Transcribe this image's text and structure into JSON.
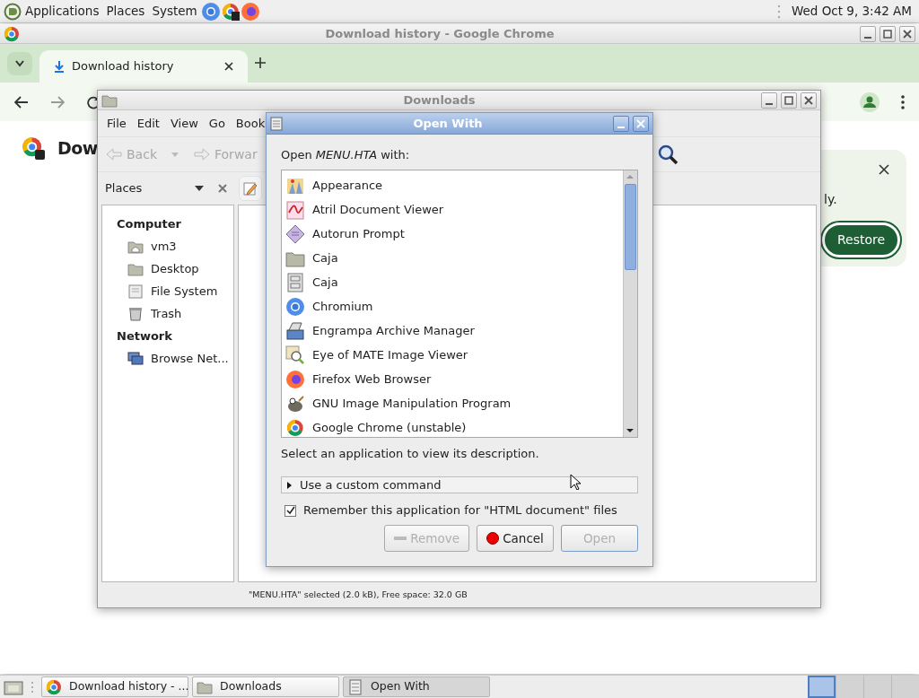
{
  "top_panel": {
    "menus": [
      {
        "label": "Applications"
      },
      {
        "label": "Places"
      },
      {
        "label": "System"
      }
    ],
    "clock": "Wed Oct 9, 3:42 AM"
  },
  "browser": {
    "title": "Download history - Google Chrome",
    "tabs": [
      {
        "label": "Download history",
        "selected": true
      }
    ],
    "page_title": "Dow",
    "notice_text": "ly.",
    "restore_button": "Restore"
  },
  "file_manager": {
    "title": "Downloads",
    "menus": [
      "File",
      "Edit",
      "View",
      "Go",
      "Book"
    ],
    "toolbar": [
      {
        "label": "Back",
        "kind": "back",
        "disabled": true
      },
      {
        "label": "Forwar",
        "kind": "forward",
        "disabled": true
      }
    ],
    "sidebar_title": "Places",
    "sidebar": [
      {
        "heading": "Computer",
        "items": [
          {
            "label": "vm3",
            "kind": "home"
          },
          {
            "label": "Desktop",
            "kind": "desktop"
          },
          {
            "label": "File System",
            "kind": "drive"
          },
          {
            "label": "Trash",
            "kind": "trash"
          }
        ]
      },
      {
        "heading": "Network",
        "items": [
          {
            "label": "Browse Net...",
            "kind": "network"
          }
        ]
      }
    ],
    "status": "\"MENU.HTA\" selected (2.0 kB), Free space: 32.0 GB"
  },
  "dialog": {
    "title": "Open With",
    "prompt": "Open *MENU.HTA* with:",
    "apps": [
      {
        "name": "Appearance",
        "kind": "appearance"
      },
      {
        "name": "Atril Document Viewer",
        "kind": "pdf"
      },
      {
        "name": "Autorun Prompt",
        "kind": "autorun"
      },
      {
        "name": "Caja",
        "kind": "folder"
      },
      {
        "name": "Caja",
        "kind": "cabinet"
      },
      {
        "name": "Chromium",
        "kind": "chromium"
      },
      {
        "name": "Engrampa Archive Manager",
        "kind": "archive"
      },
      {
        "name": "Eye of MATE Image Viewer",
        "kind": "viewer"
      },
      {
        "name": "Firefox Web Browser",
        "kind": "firefox"
      },
      {
        "name": "GNU Image Manipulation Program",
        "kind": "gimp"
      },
      {
        "name": "Google Chrome (unstable)",
        "kind": "chrome"
      }
    ],
    "description": "Select an application to view its description.",
    "expander": {
      "label": "Use a custom command",
      "expanded": false
    },
    "remember": {
      "label": "Remember this application for \"HTML document\" files",
      "checked": true
    },
    "buttons": [
      {
        "label": "Remove",
        "kind": "remove",
        "disabled": true
      },
      {
        "label": "Cancel",
        "kind": "cancel",
        "disabled": false
      },
      {
        "label": "Open",
        "kind": "open",
        "disabled": true
      }
    ]
  },
  "taskbar": {
    "tasks": [
      {
        "label": "Download history - ...",
        "kind": "chrome",
        "selected": false
      },
      {
        "label": "Downloads",
        "kind": "folder",
        "selected": false
      },
      {
        "label": "Open With",
        "kind": "dialog",
        "selected": true
      }
    ],
    "workspaces": [
      {
        "selected": true
      },
      {
        "selected": false
      },
      {
        "selected": false
      },
      {
        "selected": false
      }
    ]
  }
}
